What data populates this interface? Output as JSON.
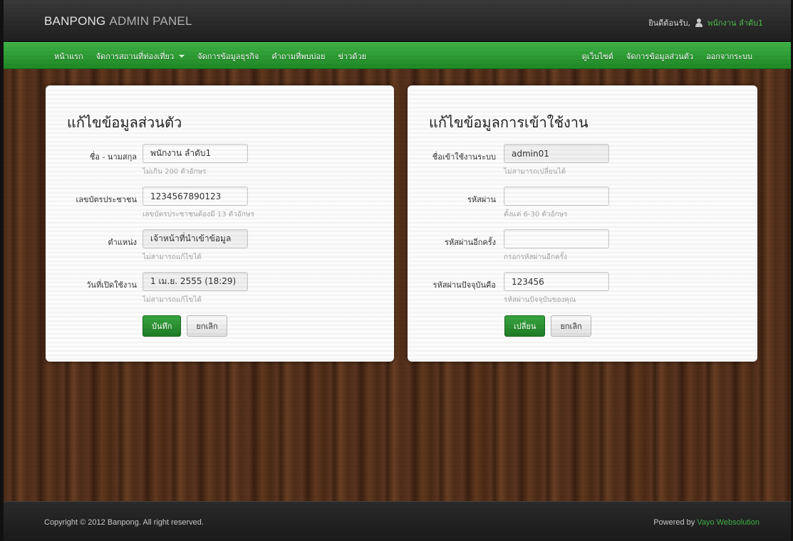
{
  "header": {
    "brand_bold": "BANPONG",
    "brand_light": "ADMIN PANEL",
    "welcome_text": "ยินดีต้อนรับ,",
    "user_name": "พนักงาน ลำดับ1"
  },
  "nav": {
    "left": [
      {
        "label": "หน้าแรก"
      },
      {
        "label": "จัดการสถานที่ท่องเที่ยว"
      },
      {
        "label": "จัดการข้อมูลธุรกิจ"
      },
      {
        "label": "คำถามที่พบบ่อย"
      },
      {
        "label": "ข่าวด้วย"
      }
    ],
    "right": [
      {
        "label": "ดูเว็บไซต์"
      },
      {
        "label": "จัดการข้อมูลส่วนตัว"
      },
      {
        "label": "ออกจากระบบ"
      }
    ]
  },
  "profile": {
    "title": "แก้ไขข้อมูลส่วนตัว",
    "fields": [
      {
        "label": "ชื่อ - นามสกุล",
        "value": "พนักงาน ลำดับ1",
        "help": "ไม่เกิน 200 ตัวอักษร"
      },
      {
        "label": "เลขบัตรประชาชน",
        "value": "1234567890123",
        "help": "เลขบัตรประชาชนต้องมี 13 ตัวอักษร"
      },
      {
        "label": "ตำแหน่ง",
        "value": "เจ้าหน้าที่นำเข้าข้อมูล",
        "help": "ไม่สามารถแก้ไขได้"
      },
      {
        "label": "วันที่เปิดใช้งาน",
        "value": "1 เม.ย. 2555 (18:29)",
        "help": "ไม่สามารถแก้ไขได้"
      }
    ],
    "save_label": "บันทึก",
    "cancel_label": "ยกเลิก"
  },
  "login": {
    "title": "แก้ไขข้อมูลการเข้าใช้งาน",
    "fields": [
      {
        "label": "ชื่อเข้าใช้งานระบบ",
        "value": "admin01",
        "help": "ไม่สามารถเปลี่ยนได้"
      },
      {
        "label": "รหัสผ่าน",
        "value": "",
        "help": "ตั้งแต่ 6-30 ตัวอักษร"
      },
      {
        "label": "รหัสผ่านอีกครั้ง",
        "value": "",
        "help": "กรอกรหัสผ่านอีกครั้ง"
      },
      {
        "label": "รหัสผ่านปัจจุบันคือ",
        "value": "123456",
        "help": "รหัสผ่านปัจจุบันของคุณ"
      }
    ],
    "change_label": "เปลี่ยน",
    "cancel_label": "ยกเลิก"
  },
  "footer": {
    "copyright": "Copyright © 2012 Banpong. All right reserved.",
    "powered_prefix": "Powered by",
    "powered_name": "Vayo Websolution"
  }
}
